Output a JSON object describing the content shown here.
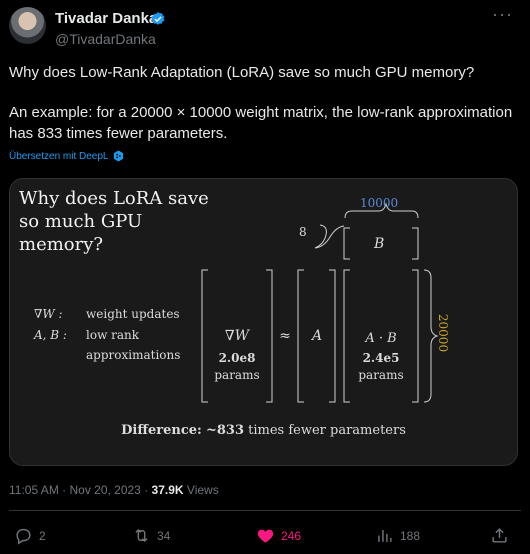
{
  "author": {
    "name": "Tivadar Danka",
    "handle": "@TivadarDanka"
  },
  "tweet": {
    "line1": "Why does Low-Rank Adaptation (LoRA) save so much GPU memory?",
    "line2": "An example: for a 20000 × 10000 weight matrix, the low-rank approximation has 833 times fewer parameters.",
    "translate": "Übersetzen mit DeepL"
  },
  "image": {
    "title_lines": [
      "Why does LoRA save",
      "so much GPU",
      "memory?"
    ],
    "legend": [
      {
        "symbol": "∇W :",
        "text": "weight updates"
      },
      {
        "symbol": "A, B :",
        "text": "low rank"
      },
      {
        "symbol": "",
        "text": "approximations"
      }
    ],
    "rank_label": "8",
    "width_label": "10000",
    "height_label": "20000",
    "matrix_B": "B",
    "matrix_grad": "∇W",
    "grad_params": "2.0e8",
    "params_word": "params",
    "approx": "≈",
    "matrix_A": "A",
    "product": "A · B",
    "product_params": "2.4e5",
    "difference_label": "Difference:",
    "difference_value": "~833",
    "difference_text": "times fewer parameters",
    "colors": {
      "width_label": "#5b8bd6",
      "height_label": "#c9a227"
    }
  },
  "meta": {
    "time": "11:05 AM · Nov 20, 2023",
    "views_count": "37.9K",
    "views_label": "Views"
  },
  "actions": {
    "replies": "2",
    "reposts": "34",
    "likes": "246",
    "bookmarks": "188"
  },
  "colors": {
    "accent": "#1d9bf0",
    "like": "#f91880",
    "muted": "#71767b"
  }
}
